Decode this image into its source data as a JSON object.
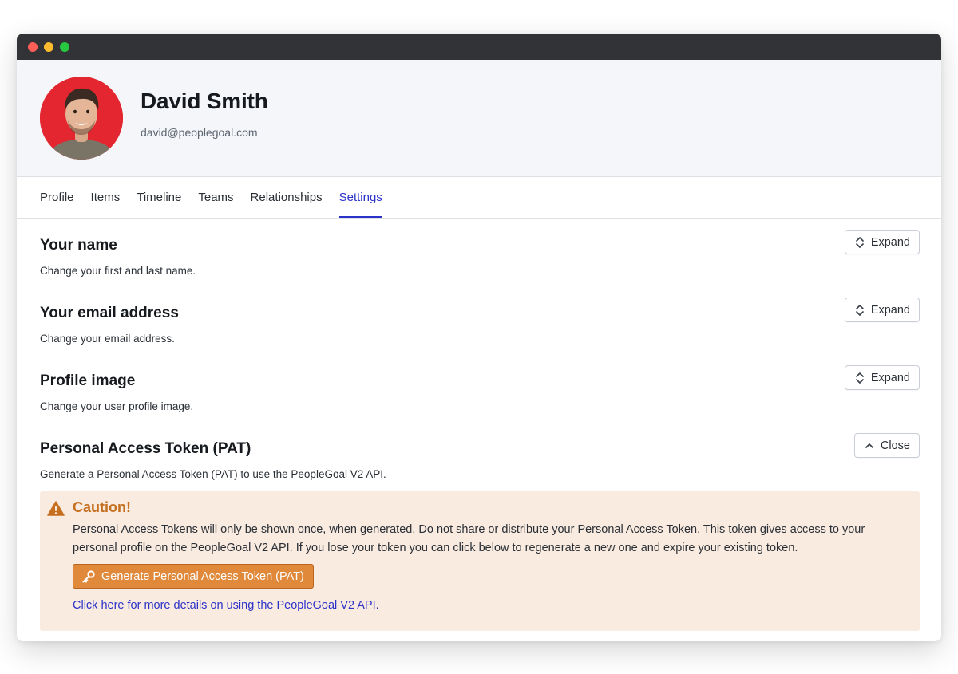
{
  "window": {
    "controls": [
      {
        "name": "close",
        "color": "#ff5f57"
      },
      {
        "name": "minimize",
        "color": "#febc2e"
      },
      {
        "name": "zoom",
        "color": "#28c840"
      }
    ]
  },
  "profile": {
    "name": "David Smith",
    "email": "david@peoplegoal.com",
    "avatar_bg": "#e3262f"
  },
  "tabs": [
    {
      "label": "Profile",
      "active": false
    },
    {
      "label": "Items",
      "active": false
    },
    {
      "label": "Timeline",
      "active": false
    },
    {
      "label": "Teams",
      "active": false
    },
    {
      "label": "Relationships",
      "active": false
    },
    {
      "label": "Settings",
      "active": true
    }
  ],
  "sections": {
    "name": {
      "title": "Your name",
      "description": "Change your first and last name.",
      "button_label": "Expand",
      "button_icon": "chevron-up-down-icon"
    },
    "email": {
      "title": "Your email address",
      "description": "Change your email address.",
      "button_label": "Expand",
      "button_icon": "chevron-up-down-icon"
    },
    "image": {
      "title": "Profile image",
      "description": "Change your user profile image.",
      "button_label": "Expand",
      "button_icon": "chevron-up-down-icon"
    },
    "pat": {
      "title": "Personal Access Token (PAT)",
      "description": "Generate a Personal Access Token (PAT) to use the PeopleGoal V2 API.",
      "button_label": "Close",
      "button_icon": "chevron-up-icon"
    }
  },
  "caution": {
    "title": "Caution!",
    "text": "Personal Access Tokens will only be shown once, when generated. Do not share or distribute your Personal Access Token. This token gives access to your personal profile on the PeopleGoal V2 API. If you lose your token you can click below to regenerate a new one and expire your existing token.",
    "generate_button_label": "Generate Personal Access Token (PAT)",
    "link_text": "Click here for more details on using the PeopleGoal V2 API.",
    "colors": {
      "background": "#f9ebe0",
      "accent": "#e0893a",
      "title": "#c56f1f"
    }
  },
  "colors": {
    "active_tab": "#2b31c9",
    "link": "#2b31c9"
  }
}
